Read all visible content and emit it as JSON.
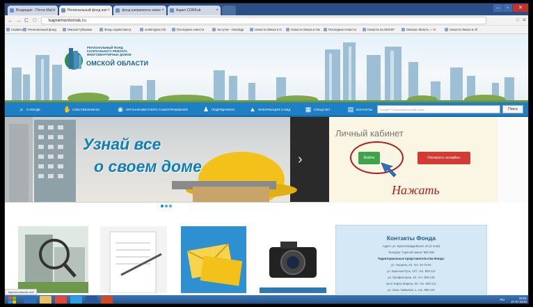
{
  "browser": {
    "tabs": [
      {
        "label": "Входящие - Почта Mail.r"
      },
      {
        "label": "Региональный фонд кап"
      },
      {
        "label": "фонд капремонта новос"
      },
      {
        "label": "Ацикл CORKub"
      }
    ],
    "url": "kapremontomsk.ru",
    "bookmarks": [
      "Сервисы",
      "Региональный фонд",
      "Омская Губернии",
      "Фонд содействия р",
      "omskregion.info",
      "Последние новости",
      "За сутки - ОмскЗдр",
      "Новости Омска и О",
      "Новости Омска и Ом",
      "Последние Новости",
      "Новости на ОМСКР",
      "Омская область — О",
      "Новости Омска и об"
    ]
  },
  "site": {
    "logo_text_lines": [
      "Региональный фонд",
      "капитального ремонта",
      "многоквартирных домов"
    ],
    "logo_title": "Омской области",
    "nav": [
      {
        "label": "О фонде",
        "icon": "search-icon"
      },
      {
        "label": "Собственникам",
        "icon": "handshake-icon"
      },
      {
        "label": "Органам местного самоуправления",
        "icon": "globe-icon"
      },
      {
        "label": "Подрядчикам",
        "icon": "people-icon"
      },
      {
        "label": "Информация о МКД",
        "icon": "warning-icon"
      },
      {
        "label": "Спецсчет",
        "icon": "building-icon"
      },
      {
        "label": "Контакты",
        "icon": "contact-icon"
      }
    ],
    "search_placeholder": "Google™ Пользовательский поиск",
    "search_button": "Поиск",
    "slide_line1": "Узнай все",
    "slide_line2": "о своем доме",
    "cabinet_title": "Личный кабинет",
    "login_button": "Войти",
    "pay_button": "Оплатить онлайн»",
    "annotation": "Нажать",
    "contacts": {
      "title": "Контакты Фонда",
      "lines": [
        {
          "text": "Адрес: ул. Красногвардейская, 24 (2 этаж)",
          "bold": false
        },
        {
          "text": "Телефон \"горячей линии\" 900-300",
          "bold": false
        },
        {
          "text": "Территориальные представительства Фонда:",
          "bold": true
        },
        {
          "text": "ул. Герцена, 25, тел. 24-72-91",
          "bold": false
        },
        {
          "text": "ул. Красный Путь, 107, тел. 900-113",
          "bold": false
        },
        {
          "text": "ул. Профинтерна, 10, тел. 900-126",
          "bold": false
        },
        {
          "text": "пр-кт Карла Маркса, 62, тел. 900-121",
          "bold": false
        },
        {
          "text": "ул. Лизы Чайкиной, 1, тел. 900-142",
          "bold": false
        }
      ]
    },
    "status_url": "kapremontomsk.ru/#"
  },
  "taskbar": {
    "clock_time": "16:51",
    "clock_date": "27.07.2015",
    "lang": "RU"
  },
  "colors": {
    "nav_blue": "#1f7fc4",
    "login_green": "#3ea34a",
    "pay_red": "#d13b34",
    "annotation_red": "#b21a1a"
  }
}
